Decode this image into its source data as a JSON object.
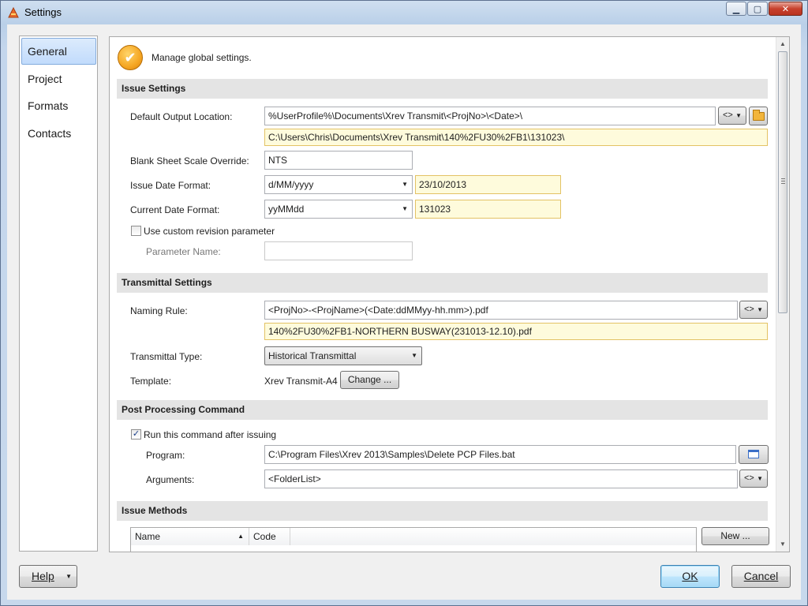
{
  "window": {
    "title": "Settings"
  },
  "nav": {
    "items": [
      "General",
      "Project",
      "Formats",
      "Contacts"
    ],
    "active": "General"
  },
  "header": {
    "text": "Manage global settings."
  },
  "issue_settings": {
    "title": "Issue Settings",
    "output_location_label": "Default Output Location:",
    "output_location_value": "%UserProfile%\\Documents\\Xrev Transmit\\<ProjNo>\\<Date>\\",
    "output_location_preview": "C:\\Users\\Chris\\Documents\\Xrev Transmit\\140%2FU30%2FB1\\131023\\",
    "insert_button_label": "<>",
    "blank_scale_label": "Blank Sheet Scale Override:",
    "blank_scale_value": "NTS",
    "issue_date_label": "Issue Date Format:",
    "issue_date_format": "d/MM/yyyy",
    "issue_date_preview": "23/10/2013",
    "current_date_label": "Current Date Format:",
    "current_date_format": "yyMMdd",
    "current_date_preview": "131023",
    "custom_revision_label": "Use custom revision parameter",
    "parameter_name_label": "Parameter Name:",
    "parameter_name_value": ""
  },
  "transmittal_settings": {
    "title": "Transmittal Settings",
    "naming_rule_label": "Naming Rule:",
    "naming_rule_value": "<ProjNo>-<ProjName>(<Date:ddMMyy-hh.mm>).pdf",
    "naming_rule_preview": "140%2FU30%2FB1-NORTHERN BUSWAY(231013-12.10).pdf",
    "insert_button_label": "<>",
    "type_label": "Transmittal Type:",
    "type_value": "Historical Transmittal",
    "template_label": "Template:",
    "template_value": "Xrev Transmit-A4",
    "change_button": "Change ..."
  },
  "post_processing": {
    "title": "Post Processing Command",
    "run_label": "Run this command after issuing",
    "run_checked": true,
    "program_label": "Program:",
    "program_value": "C:\\Program Files\\Xrev 2013\\Samples\\Delete PCP Files.bat",
    "arguments_label": "Arguments:",
    "arguments_value": "<FolderList>",
    "insert_button_label": "<>"
  },
  "issue_methods": {
    "title": "Issue Methods",
    "columns": [
      "Name",
      "Code"
    ],
    "new_button": "New ..."
  },
  "footer": {
    "help_button": "Help",
    "ok_button": "OK",
    "cancel_button": "Cancel"
  },
  "icons": {
    "check": "check-icon",
    "folder": "folder-icon",
    "program": "window-icon",
    "dropdown": "chevron-down-icon"
  }
}
